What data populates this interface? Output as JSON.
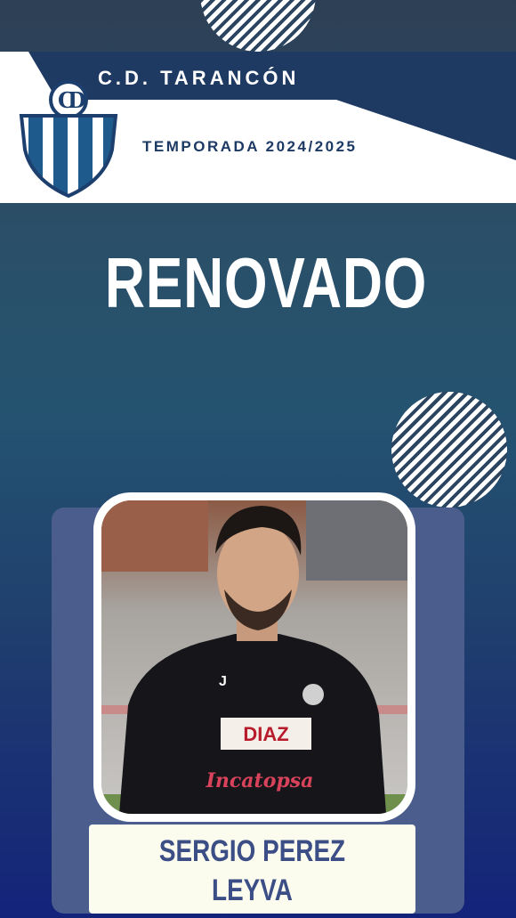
{
  "header": {
    "club_name": "C.D. TARANCÓN",
    "season_label": "TEMPORADA 2024/2025",
    "crest_initials": "CD"
  },
  "headline": "RENOVADO",
  "player": {
    "name_line1": "SERGIO PEREZ",
    "name_line2": "LEYVA",
    "shirt_text_1": "DIAZ",
    "shirt_text_2": "Incatopsa"
  },
  "colors": {
    "navy": "#1c3a63",
    "name_text": "#3c4e86",
    "card": "#4a5d8d",
    "name_box": "#fbfbee"
  }
}
